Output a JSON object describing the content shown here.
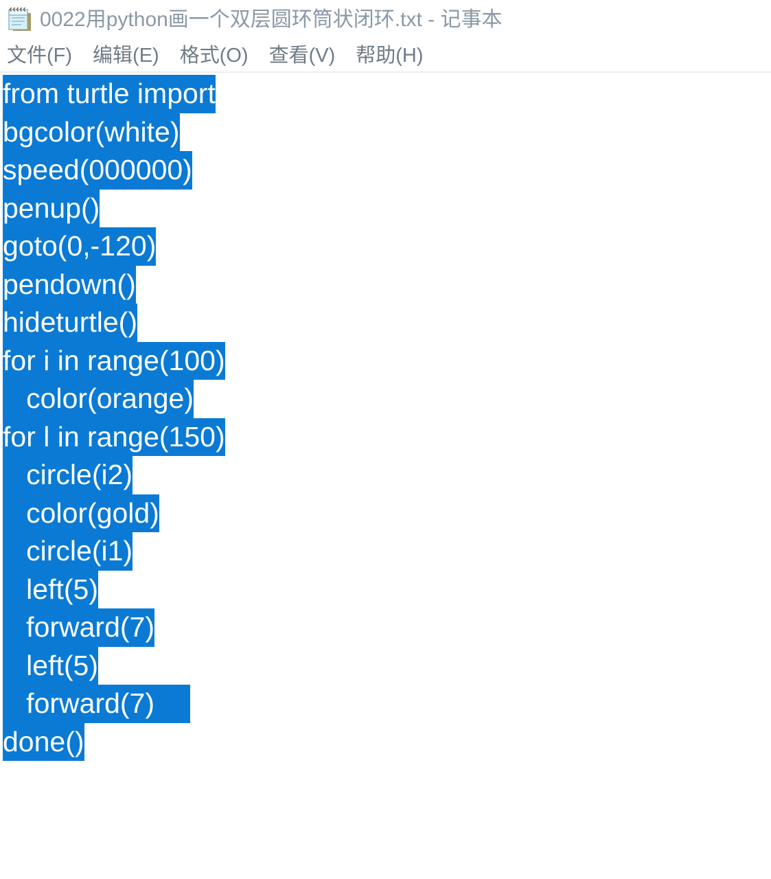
{
  "window": {
    "app_icon": "notepad-icon",
    "title": "0022用python画一个双层圆环筒状闭环.txt - 记事本",
    "file_name": "0022用python画一个双层圆环筒状闭环.txt",
    "app_name": "记事本"
  },
  "menubar": {
    "items": [
      {
        "label": "文件(F)",
        "name": "file"
      },
      {
        "label": "编辑(E)",
        "name": "edit"
      },
      {
        "label": "格式(O)",
        "name": "format"
      },
      {
        "label": "查看(V)",
        "name": "view"
      },
      {
        "label": "帮助(H)",
        "name": "help"
      }
    ]
  },
  "editor": {
    "selection_color": "#0a7ad4",
    "selection_text_color": "#ffffff",
    "all_selected": true,
    "lines": [
      {
        "text": "from turtle import",
        "selected": true
      },
      {
        "text": "bgcolor(white)",
        "selected": true
      },
      {
        "text": "speed(000000)",
        "selected": true
      },
      {
        "text": "penup()",
        "selected": true
      },
      {
        "text": "goto(0,-120)",
        "selected": true
      },
      {
        "text": "pendown()",
        "selected": true
      },
      {
        "text": "hideturtle()",
        "selected": true
      },
      {
        "text": "for i in range(100)",
        "selected": true
      },
      {
        "text": "   color(orange)",
        "selected": true
      },
      {
        "text": "for l in range(150)",
        "selected": true
      },
      {
        "text": "   circle(i2)",
        "selected": true
      },
      {
        "text": "   color(gold)",
        "selected": true
      },
      {
        "text": "   circle(i1)",
        "selected": true
      },
      {
        "text": "   left(5)",
        "selected": true
      },
      {
        "text": "   forward(7)",
        "selected": true
      },
      {
        "text": "   left(5)",
        "selected": true
      },
      {
        "text": "   forward(7)",
        "selected": true,
        "trailing_newline": true
      },
      {
        "text": "done()",
        "selected": true
      }
    ]
  }
}
